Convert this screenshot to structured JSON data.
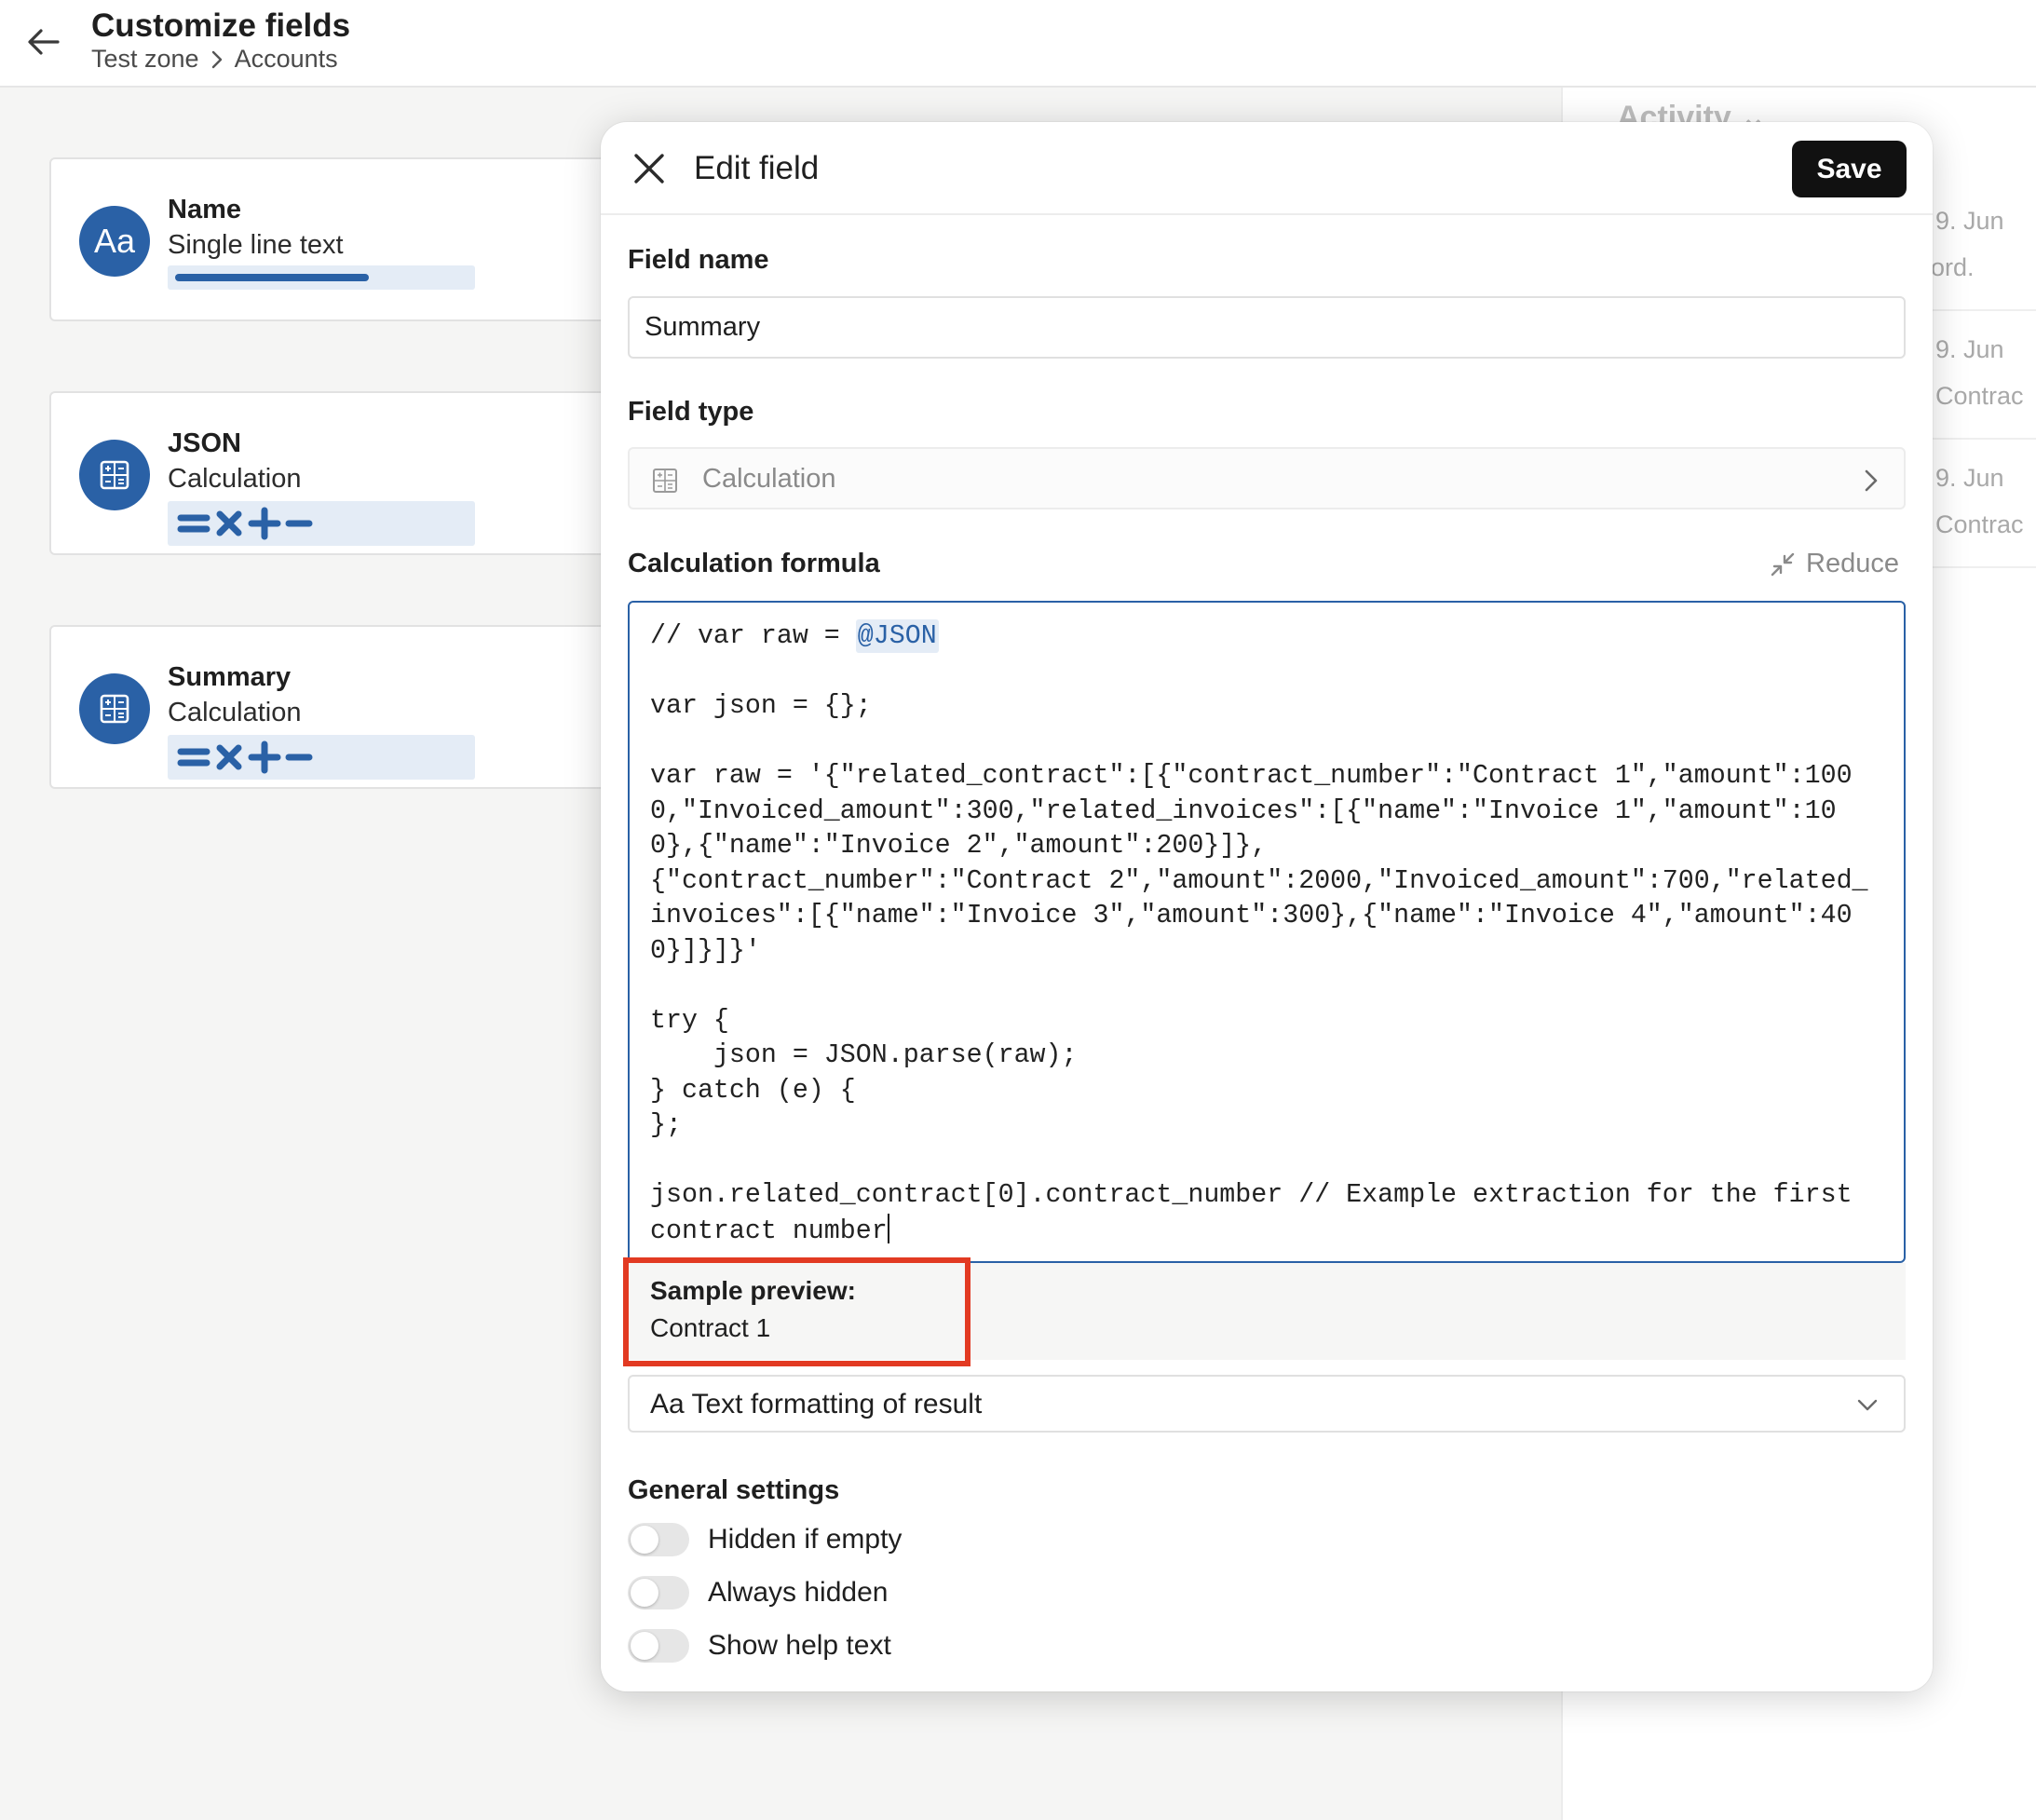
{
  "header": {
    "title": "Customize fields",
    "breadcrumb": [
      "Test zone",
      "Accounts"
    ]
  },
  "fields": [
    {
      "title": "Name",
      "type": "Single line text",
      "icon": "text-icon",
      "icon_text": "Aa"
    },
    {
      "title": "JSON",
      "type": "Calculation",
      "icon": "calculator-icon"
    },
    {
      "title": "Summary",
      "type": "Calculation",
      "icon": "calculator-icon"
    }
  ],
  "activity": {
    "title": "Activity",
    "items": [
      {
        "date": "9. Jun",
        "text": "ord."
      },
      {
        "date": "9. Jun",
        "text": "Contrac"
      },
      {
        "date": "9. Jun",
        "text": "Contrac"
      }
    ]
  },
  "modal": {
    "title": "Edit field",
    "save_label": "Save",
    "field_name_label": "Field name",
    "field_name_value": "Summary",
    "field_type_label": "Field type",
    "field_type_value": "Calculation",
    "formula_label": "Calculation formula",
    "reduce_label": "Reduce",
    "formula": {
      "line1_prefix": "// var raw = ",
      "line1_ref": "@JSON",
      "body": "\n\nvar json = {};\n\nvar raw = '{\"related_contract\":[{\"contract_number\":\"Contract 1\",\"amount\":1000,\"Invoiced_amount\":300,\"related_invoices\":[{\"name\":\"Invoice 1\",\"amount\":100},{\"name\":\"Invoice 2\",\"amount\":200}]},\n{\"contract_number\":\"Contract 2\",\"amount\":2000,\"Invoiced_amount\":700,\"related_invoices\":[{\"name\":\"Invoice 3\",\"amount\":300},{\"name\":\"Invoice 4\",\"amount\":400}]}]}'\n\ntry {\n    json = JSON.parse(raw);\n} catch (e) {\n};\n\njson.related_contract[0].contract_number // Example extraction for the first contract number"
    },
    "preview_title": "Sample preview:",
    "preview_value": "Contract 1",
    "format_label": "Aa Text formatting of result",
    "general_settings_label": "General settings",
    "toggles": [
      {
        "label": "Hidden if empty",
        "on": false
      },
      {
        "label": "Always hidden",
        "on": false
      },
      {
        "label": "Show help text",
        "on": false
      }
    ]
  },
  "colors": {
    "accent": "#2a61a6",
    "highlight": "#e23a22",
    "save_button": "#111111"
  }
}
